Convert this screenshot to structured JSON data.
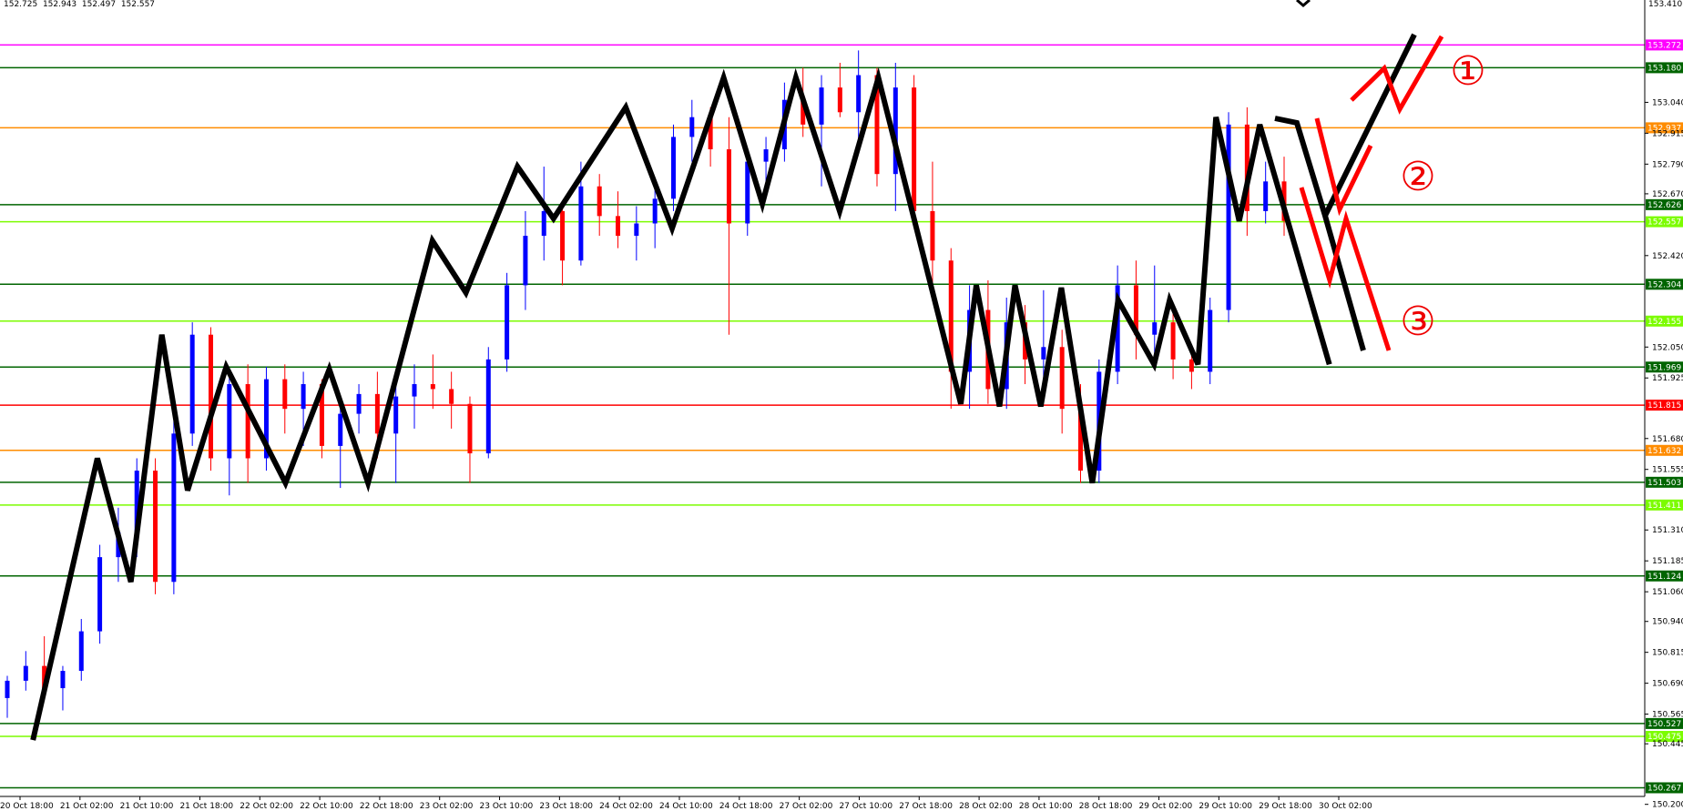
{
  "header": {
    "ohlc": "152.725  152.943  152.497  152.557",
    "top_price": "153.410"
  },
  "chart_data": {
    "type": "candlestick",
    "ylim": [
      150.232,
      153.454
    ],
    "price_ticks": [
      "153.040",
      "152.915",
      "152.790",
      "152.670",
      "152.420",
      "152.050",
      "151.925",
      "151.680",
      "151.555",
      "151.310",
      "151.185",
      "151.060",
      "150.940",
      "150.815",
      "150.690",
      "150.565",
      "150.445",
      "150.200"
    ],
    "time_labels": [
      "20 Oct 18:00",
      "21 Oct 02:00",
      "21 Oct 10:00",
      "21 Oct 18:00",
      "22 Oct 02:00",
      "22 Oct 10:00",
      "22 Oct 18:00",
      "23 Oct 02:00",
      "23 Oct 10:00",
      "23 Oct 18:00",
      "24 Oct 02:00",
      "24 Oct 10:00",
      "24 Oct 18:00",
      "27 Oct 02:00",
      "27 Oct 10:00",
      "27 Oct 18:00",
      "28 Oct 02:00",
      "28 Oct 10:00",
      "28 Oct 18:00",
      "29 Oct 02:00",
      "29 Oct 10:00",
      "29 Oct 18:00",
      "30 Oct 02:00"
    ],
    "levels": [
      {
        "price": "153.272",
        "color": "#ff00ff",
        "value": 153.272
      },
      {
        "price": "153.180",
        "color": "#006400",
        "value": 153.18
      },
      {
        "price": "152.937",
        "color": "#ff8c00",
        "value": 152.937
      },
      {
        "price": "152.626",
        "color": "#006400",
        "value": 152.626
      },
      {
        "price": "152.557",
        "color": "#7cfc00",
        "value": 152.557
      },
      {
        "price": "152.304",
        "color": "#006400",
        "value": 152.304
      },
      {
        "price": "152.155",
        "color": "#7cfc00",
        "value": 152.155
      },
      {
        "price": "151.969",
        "color": "#006400",
        "value": 151.969
      },
      {
        "price": "151.815",
        "color": "#ff0000",
        "value": 151.815
      },
      {
        "price": "151.632",
        "color": "#ff8c00",
        "value": 151.632
      },
      {
        "price": "151.503",
        "color": "#006400",
        "value": 151.503
      },
      {
        "price": "151.411",
        "color": "#7cfc00",
        "value": 151.411
      },
      {
        "price": "151.124",
        "color": "#006400",
        "value": 151.124
      },
      {
        "price": "150.527",
        "color": "#006400",
        "value": 150.527
      },
      {
        "price": "150.475",
        "color": "#7cfc00",
        "value": 150.475
      },
      {
        "price": "150.267",
        "color": "#006400",
        "value": 150.267
      }
    ],
    "zigzag": [
      [
        0.5,
        150.46
      ],
      [
        3.0,
        151.6
      ],
      [
        4.3,
        151.1
      ],
      [
        5.5,
        152.1
      ],
      [
        6.5,
        151.47
      ],
      [
        8.0,
        151.97
      ],
      [
        10.3,
        151.5
      ],
      [
        12.0,
        151.96
      ],
      [
        13.5,
        151.5
      ],
      [
        16.0,
        152.48
      ],
      [
        17.3,
        152.27
      ],
      [
        19.3,
        152.78
      ],
      [
        20.7,
        152.57
      ],
      [
        23.5,
        153.02
      ],
      [
        25.3,
        152.53
      ],
      [
        27.3,
        153.14
      ],
      [
        28.8,
        152.63
      ],
      [
        30.1,
        153.14
      ],
      [
        31.8,
        152.6
      ],
      [
        33.3,
        153.14
      ],
      [
        36.5,
        151.82
      ],
      [
        37.1,
        152.3
      ],
      [
        38.0,
        151.81
      ],
      [
        38.6,
        152.3
      ],
      [
        39.6,
        151.81
      ],
      [
        40.4,
        152.29
      ],
      [
        41.6,
        151.5
      ],
      [
        42.6,
        152.24
      ],
      [
        44.0,
        151.98
      ],
      [
        44.6,
        152.24
      ],
      [
        45.7,
        151.98
      ],
      [
        46.4,
        152.98
      ],
      [
        47.3,
        152.56
      ],
      [
        48.1,
        152.95
      ],
      [
        50.8,
        151.98
      ]
    ],
    "scenarios": [
      {
        "name": "①",
        "path": [
          [
            48.0,
            152.57
          ],
          [
            50.6,
            153.27
          ]
        ]
      },
      {
        "name": "②",
        "path": [
          [
            48.2,
            152.57
          ],
          [
            47.4,
            152.85
          ]
        ]
      },
      {
        "name": "③",
        "path": [
          [
            48.2,
            152.57
          ],
          [
            50.8,
            151.98
          ]
        ]
      }
    ],
    "circled_numbers": [
      "①",
      "②",
      "③"
    ],
    "candles": [
      [
        150.63,
        150.72,
        150.55,
        150.7
      ],
      [
        150.7,
        150.82,
        150.66,
        150.76
      ],
      [
        150.76,
        150.88,
        150.65,
        150.67
      ],
      [
        150.67,
        150.76,
        150.58,
        150.74
      ],
      [
        150.74,
        150.95,
        150.7,
        150.9
      ],
      [
        150.9,
        151.25,
        150.85,
        151.2
      ],
      [
        151.2,
        151.4,
        151.1,
        151.3
      ],
      [
        151.3,
        151.6,
        151.2,
        151.55
      ],
      [
        151.55,
        151.6,
        151.05,
        151.1
      ],
      [
        151.1,
        151.75,
        151.05,
        151.7
      ],
      [
        151.7,
        152.15,
        151.65,
        152.1
      ],
      [
        152.1,
        152.13,
        151.55,
        151.6
      ],
      [
        151.6,
        151.95,
        151.45,
        151.9
      ],
      [
        151.9,
        151.98,
        151.5,
        151.6
      ],
      [
        151.6,
        151.97,
        151.55,
        151.92
      ],
      [
        151.92,
        151.98,
        151.7,
        151.8
      ],
      [
        151.8,
        151.95,
        151.65,
        151.9
      ],
      [
        151.9,
        151.92,
        151.6,
        151.65
      ],
      [
        151.65,
        151.85,
        151.48,
        151.78
      ],
      [
        151.78,
        151.9,
        151.7,
        151.86
      ],
      [
        151.86,
        151.95,
        151.6,
        151.7
      ],
      [
        151.7,
        151.92,
        151.5,
        151.85
      ],
      [
        151.85,
        151.98,
        151.72,
        151.9
      ],
      [
        151.9,
        152.02,
        151.8,
        151.88
      ],
      [
        151.88,
        151.95,
        151.72,
        151.82
      ],
      [
        151.82,
        151.85,
        151.5,
        151.62
      ],
      [
        151.62,
        152.05,
        151.6,
        152.0
      ],
      [
        152.0,
        152.35,
        151.95,
        152.3
      ],
      [
        152.3,
        152.6,
        152.2,
        152.5
      ],
      [
        152.5,
        152.78,
        152.4,
        152.6
      ],
      [
        152.6,
        152.62,
        152.3,
        152.4
      ],
      [
        152.4,
        152.8,
        152.38,
        152.7
      ],
      [
        152.7,
        152.75,
        152.5,
        152.58
      ],
      [
        152.58,
        152.68,
        152.45,
        152.5
      ],
      [
        152.5,
        152.62,
        152.4,
        152.55
      ],
      [
        152.55,
        152.7,
        152.45,
        152.65
      ],
      [
        152.65,
        152.95,
        152.6,
        152.9
      ],
      [
        152.9,
        153.05,
        152.8,
        152.98
      ],
      [
        152.98,
        153.02,
        152.78,
        152.85
      ],
      [
        152.85,
        152.98,
        152.1,
        152.55
      ],
      [
        152.55,
        152.85,
        152.5,
        152.8
      ],
      [
        152.8,
        152.9,
        152.7,
        152.85
      ],
      [
        152.85,
        153.12,
        152.8,
        153.05
      ],
      [
        153.05,
        153.18,
        152.9,
        152.95
      ],
      [
        152.95,
        153.15,
        152.7,
        153.1
      ],
      [
        153.1,
        153.2,
        152.98,
        153.0
      ],
      [
        153.0,
        153.25,
        152.85,
        153.15
      ],
      [
        153.15,
        153.18,
        152.7,
        152.75
      ],
      [
        152.75,
        153.2,
        152.6,
        153.1
      ],
      [
        153.1,
        153.15,
        152.55,
        152.6
      ],
      [
        152.6,
        152.8,
        152.3,
        152.4
      ],
      [
        152.4,
        152.45,
        151.8,
        151.95
      ],
      [
        151.95,
        152.3,
        151.8,
        152.2
      ],
      [
        152.2,
        152.32,
        151.82,
        151.88
      ],
      [
        151.88,
        152.25,
        151.8,
        152.15
      ],
      [
        152.15,
        152.22,
        151.9,
        152.0
      ],
      [
        152.0,
        152.28,
        151.92,
        152.05
      ],
      [
        152.05,
        152.12,
        151.7,
        151.8
      ],
      [
        151.8,
        151.9,
        151.5,
        151.55
      ],
      [
        151.55,
        152.0,
        151.5,
        151.95
      ],
      [
        151.95,
        152.38,
        151.9,
        152.3
      ],
      [
        152.3,
        152.4,
        152.0,
        152.1
      ],
      [
        152.1,
        152.38,
        152.02,
        152.15
      ],
      [
        152.15,
        152.22,
        151.92,
        152.0
      ],
      [
        152.0,
        152.05,
        151.88,
        151.95
      ],
      [
        151.95,
        152.25,
        151.9,
        152.2
      ],
      [
        152.2,
        153.0,
        152.15,
        152.95
      ],
      [
        152.95,
        153.02,
        152.5,
        152.6
      ],
      [
        152.6,
        152.8,
        152.55,
        152.72
      ],
      [
        152.72,
        152.82,
        152.5,
        152.56
      ]
    ]
  }
}
